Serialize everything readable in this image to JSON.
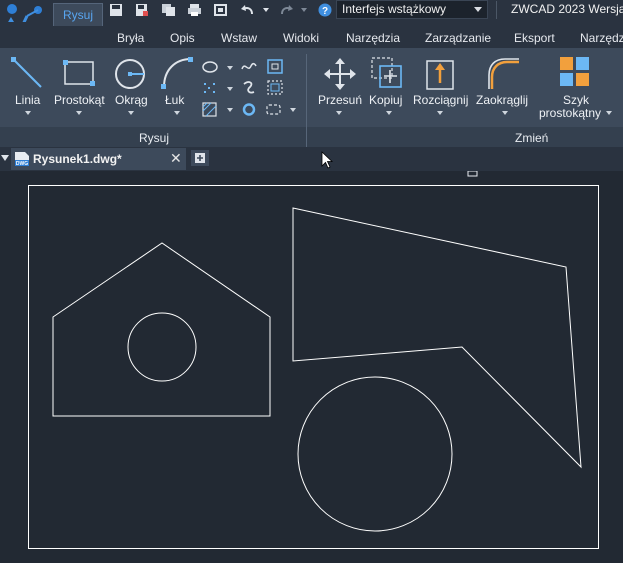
{
  "app": {
    "title": "ZWCAD 2023 Wersja"
  },
  "workspace": {
    "value": "Interfejs wstążkowy"
  },
  "ribbon_tabs": [
    "Rysuj",
    "Bryła",
    "Opis",
    "Wstaw",
    "Widoki",
    "Narzędzia",
    "Zarządzanie",
    "Eksport",
    "Narzędz"
  ],
  "draw_panel": {
    "label": "Rysuj",
    "buttons": [
      "Linia",
      "Prostokąt",
      "Okrąg",
      "Łuk"
    ]
  },
  "modify_panel": {
    "label": "Zmień",
    "buttons": [
      "Przesuń",
      "Kopiuj",
      "Rozciągnij",
      "Zaokrąglij"
    ],
    "array_label_1": "Szyk",
    "array_label_2": "prostokątny"
  },
  "document": {
    "tab_title": "Rysunek1.dwg*",
    "file_badge": "DWG"
  },
  "colors": {
    "accent": "#58a5f0",
    "background": "#222933",
    "ribbon": "#3d4a5b",
    "icon_blue": "#6cb8f5",
    "icon_orange": "#f2a03d"
  }
}
